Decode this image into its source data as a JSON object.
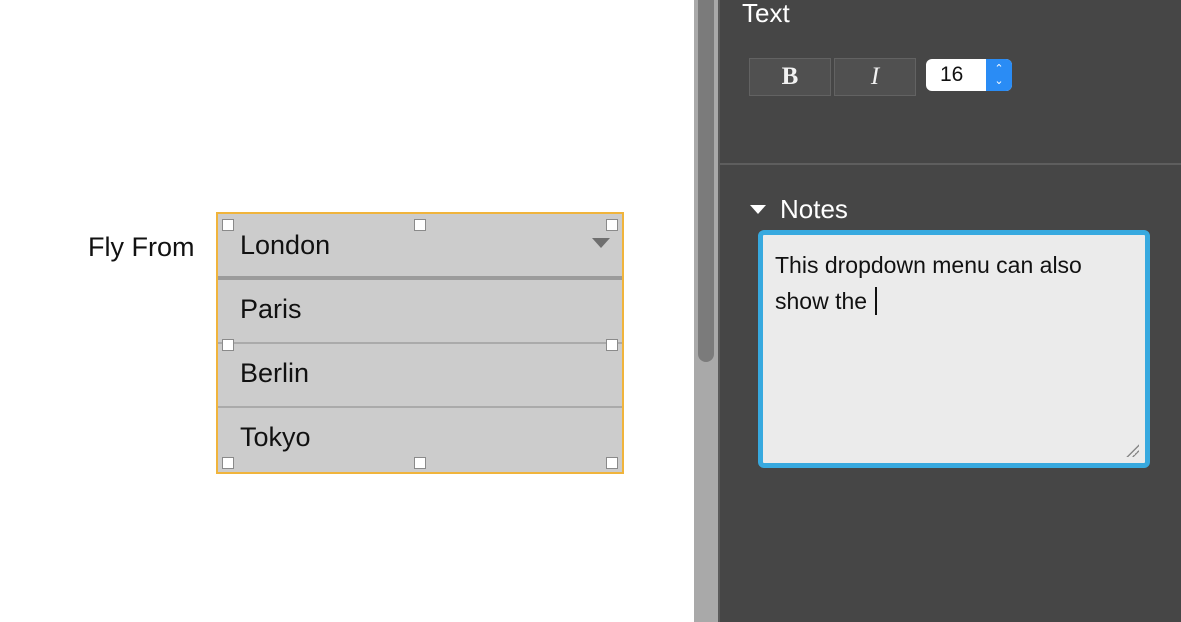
{
  "canvas": {
    "field_label": "Fly From",
    "dropdown": {
      "selected": "London",
      "options": [
        "Paris",
        "Berlin",
        "Tokyo"
      ]
    }
  },
  "inspector": {
    "text_section": {
      "title": "Text",
      "bold_label": "B",
      "italic_label": "I",
      "font_size": "16"
    },
    "notes_section": {
      "title": "Notes",
      "content": "This dropdown menu can also show the "
    }
  },
  "colors": {
    "selection_border": "#f0b43c",
    "panel_background": "#464646",
    "notes_focus_border": "#37a9df",
    "stepper_blue": "#2a8cf5"
  },
  "icons": {
    "dropdown_arrow": "triangle-down-icon",
    "notes_toggle": "disclosure-triangle-icon",
    "stepper": "up-down-chevron-icon",
    "resize": "resize-grip-icon"
  }
}
